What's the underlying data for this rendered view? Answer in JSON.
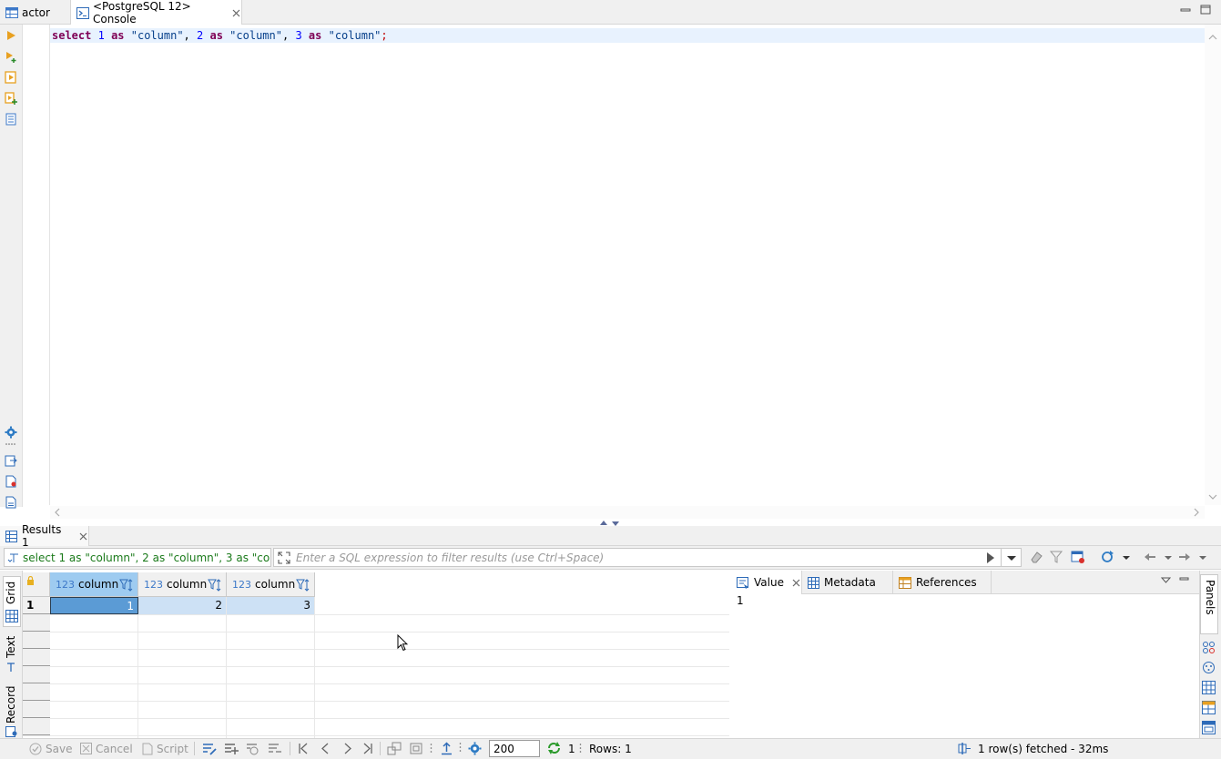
{
  "tabs": [
    {
      "label": "actor"
    },
    {
      "label": "<PostgreSQL 12> Console"
    }
  ],
  "editor": {
    "sql": {
      "kw_select": "select",
      "n1": "1",
      "kw_as1": "as",
      "s1": "\"column\"",
      "c1": ",",
      "n2": "2",
      "kw_as2": "as",
      "s2": "\"column\"",
      "c2": ",",
      "n3": "3",
      "kw_as3": "as",
      "s3": "\"column\"",
      "semi": ";"
    }
  },
  "results": {
    "tab_label": "Results 1",
    "query_text": "select 1 as \"column\", 2 as \"column\", 3 as \"column\"",
    "filter_placeholder": "Enter a SQL expression to filter results (use Ctrl+Space)",
    "side_tabs": [
      "Grid",
      "Text",
      "Record"
    ],
    "columns": [
      {
        "type": "123",
        "name": "column"
      },
      {
        "type": "123",
        "name": "column"
      },
      {
        "type": "123",
        "name": "column"
      }
    ],
    "rows": [
      {
        "num": "1",
        "cells": [
          "1",
          "2",
          "3"
        ]
      }
    ]
  },
  "value_panel": {
    "tabs": [
      {
        "label": "Value"
      },
      {
        "label": "Metadata"
      },
      {
        "label": "References"
      }
    ],
    "value": "1",
    "side_label": "Panels"
  },
  "bottom_toolbar": {
    "save_label": "Save",
    "cancel_label": "Cancel",
    "script_label": "Script",
    "page_size": "200",
    "fetch_count": "1",
    "rows_label": "Rows: 1",
    "status": "1 row(s) fetched - 32ms"
  },
  "colors": {
    "keyword": "#7f0055",
    "number": "#0000ff",
    "string": "#063f8a",
    "selected_cell": "#5b9bd5",
    "selection_tint": "#cde1f5",
    "accent_orange": "#e8a020"
  }
}
